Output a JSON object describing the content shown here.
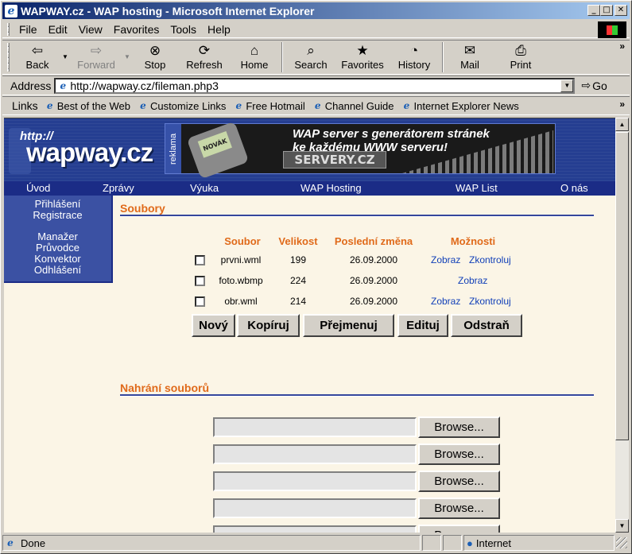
{
  "window": {
    "title": "WAPWAY.cz - WAP hosting - Microsoft Internet Explorer"
  },
  "menu": [
    "File",
    "Edit",
    "View",
    "Favorites",
    "Tools",
    "Help"
  ],
  "toolbar": {
    "back": "Back",
    "forward": "Forward",
    "stop": "Stop",
    "refresh": "Refresh",
    "home": "Home",
    "search": "Search",
    "favorites": "Favorites",
    "history": "History",
    "mail": "Mail",
    "print": "Print"
  },
  "address": {
    "label": "Address",
    "url": "http://wapway.cz/fileman.php3",
    "go": "Go"
  },
  "links": {
    "label": "Links",
    "items": [
      "Best of the Web",
      "Customize Links",
      "Free Hotmail",
      "Channel Guide",
      "Internet Explorer News"
    ]
  },
  "site": {
    "logo_http": "http://",
    "logo": "wapway.cz",
    "banner": {
      "side_label": "reklama",
      "line1": "WAP server s generátorem stránek",
      "line2": "ke každému WWW serveru!",
      "brand": "SERVERY.CZ",
      "phone_text": "NOVÁK"
    },
    "nav": [
      "Úvod",
      "Zprávy",
      "Výuka",
      "WAP Hosting",
      "WAP List",
      "O nás"
    ],
    "sidebar": [
      "Přihlášení",
      "Registrace",
      "Manažer",
      "Průvodce",
      "Konvektor",
      "Odhlášení"
    ]
  },
  "files": {
    "title": "Soubory",
    "headers": {
      "name": "Soubor",
      "size": "Velikost",
      "changed": "Poslední změna",
      "options": "Možnosti"
    },
    "rows": [
      {
        "name": "prvni.wml",
        "size": "199",
        "date": "26.09.2000",
        "view": "Zobraz",
        "check": "Zkontroluj"
      },
      {
        "name": "foto.wbmp",
        "size": "224",
        "date": "26.09.2000",
        "view": "Zobraz",
        "check": ""
      },
      {
        "name": "obr.wml",
        "size": "214",
        "date": "26.09.2000",
        "view": "Zobraz",
        "check": "Zkontroluj"
      }
    ],
    "buttons": {
      "new": "Nový",
      "copy": "Kopíruj",
      "rename": "Přejmenuj",
      "edit": "Edituj",
      "delete": "Odstraň"
    }
  },
  "upload": {
    "title": "Nahrání souborů",
    "browse": "Browse..."
  },
  "status": {
    "text": "Done",
    "zone": "Internet"
  }
}
